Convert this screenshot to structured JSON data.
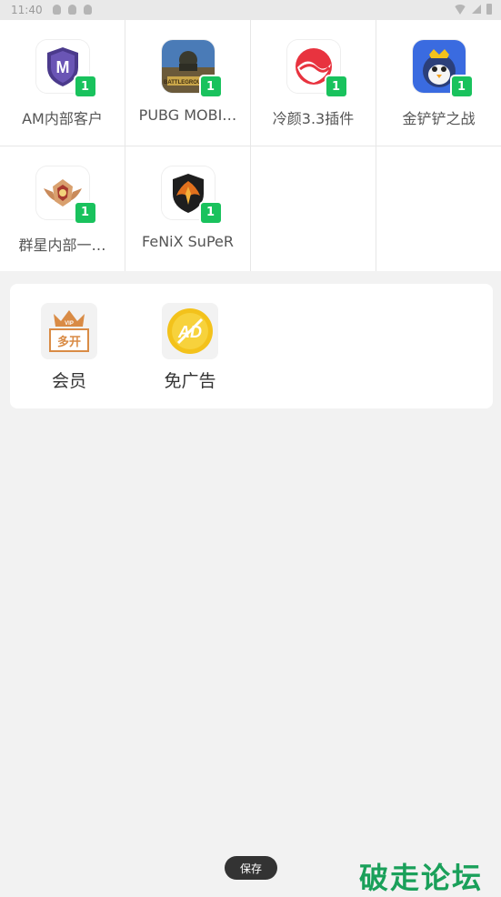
{
  "status_bar": {
    "time": "11:40"
  },
  "apps": [
    {
      "name": "AM内部客户",
      "badge": "1",
      "icon": "am-shield-icon"
    },
    {
      "name": "PUBG MOBI…",
      "badge": "1",
      "icon": "pubg-mobile-icon"
    },
    {
      "name": "冷颜3.3插件",
      "badge": "1",
      "icon": "lengyan-plugin-icon"
    },
    {
      "name": "金铲铲之战",
      "badge": "1",
      "icon": "jinchanchan-penguin-icon"
    },
    {
      "name": "群星内部一…",
      "badge": "1",
      "icon": "star-rank-emblem-icon"
    },
    {
      "name": "FeNiX SuPeR",
      "badge": "1",
      "icon": "fenix-phoenix-icon"
    }
  ],
  "features": [
    {
      "label": "会员",
      "icon": "vip-multi-open-icon",
      "icon_text_top": "VIP",
      "icon_text": "多开"
    },
    {
      "label": "免广告",
      "icon": "no-ads-coin-icon",
      "icon_text": "AD"
    }
  ],
  "toast": {
    "text": "保存"
  },
  "watermark": {
    "text": "破走论坛"
  },
  "colors": {
    "badge": "#19c25d",
    "background": "#f2f2f2",
    "watermark": "#1aa05a",
    "vip_accent": "#d98b45",
    "ad_gold": "#f3c21b"
  }
}
